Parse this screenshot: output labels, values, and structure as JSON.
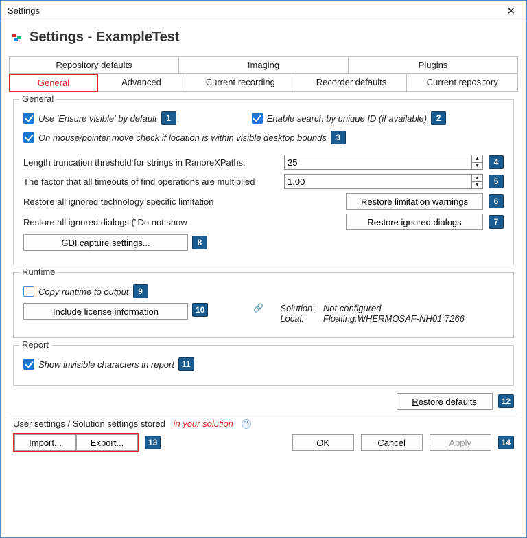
{
  "window": {
    "title": "Settings",
    "page_title": "Settings  -  ExampleTest"
  },
  "tabs": {
    "row1": [
      "Repository defaults",
      "Imaging",
      "Plugins"
    ],
    "row2": [
      "General",
      "Advanced",
      "Current recording",
      "Recorder defaults",
      "Current repository"
    ],
    "selected": "General"
  },
  "general": {
    "legend": "General",
    "ensure_visible": "Use 'Ensure visible' by default",
    "enable_search_uid": "Enable search by unique ID (if available)",
    "mouse_bounds": "On mouse/pointer move check if location is within visible desktop bounds",
    "len_trunc_label": "Length truncation threshold for strings in RanoreXPaths:",
    "len_trunc_value": "25",
    "timeout_factor_label": "The factor that all timeouts of find operations are multiplied",
    "timeout_factor_value": "1.00",
    "restore_tech_label": "Restore all ignored technology specific limitation",
    "restore_tech_btn": "Restore limitation warnings",
    "restore_dialogs_label": "Restore all ignored dialogs (\"Do not show",
    "restore_dialogs_btn": "Restore ignored dialogs",
    "gdi_btn": "GDI capture settings..."
  },
  "runtime": {
    "legend": "Runtime",
    "copy_runtime": "Copy runtime to output",
    "include_license_btn": "Include license information",
    "solution_label": "Solution:",
    "solution_value": "Not configured",
    "local_label": "Local:",
    "local_value": "Floating:WHERMOSAF-NH01:7266"
  },
  "report": {
    "legend": "Report",
    "show_invisible": "Show invisible characters in report"
  },
  "restore_defaults_btn": "Restore defaults",
  "storage": {
    "prefix": "User settings / Solution settings stored",
    "suffix": "in your solution"
  },
  "buttons": {
    "import": "Import...",
    "export": "Export...",
    "ok": "OK",
    "cancel": "Cancel",
    "apply": "Apply"
  },
  "callouts": {
    "c1": "1",
    "c2": "2",
    "c3": "3",
    "c4": "4",
    "c5": "5",
    "c6": "6",
    "c7": "7",
    "c8": "8",
    "c9": "9",
    "c10": "10",
    "c11": "11",
    "c12": "12",
    "c13": "13",
    "c14": "14"
  }
}
